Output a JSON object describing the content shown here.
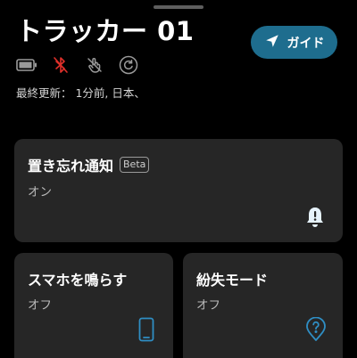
{
  "header": {
    "title": "トラッカー 01",
    "guide_button": {
      "label": "ガイド",
      "icon": "send-icon",
      "color": "#1e6d8e"
    },
    "status_icons": [
      "battery-icon",
      "bluetooth-off-icon",
      "tap-off-icon",
      "refresh-icon"
    ],
    "last_update": "最終更新： 1分前, 日本、"
  },
  "cards": {
    "lost_alert": {
      "title": "置き忘れ通知",
      "badge": "Beta",
      "state": "オン",
      "icon": "bell-alert-icon"
    },
    "ring_phone": {
      "title": "スマホを鳴らす",
      "state": "オフ",
      "icon": "smartphone-icon"
    },
    "lost_mode": {
      "title": "紛失モード",
      "state": "オフ",
      "icon": "location-question-icon"
    }
  },
  "colors": {
    "accent": "#1e6d8e",
    "icon_blue": "#2f8ec4",
    "bluetooth_off": "#e0302a",
    "card_bg": "#262626"
  }
}
